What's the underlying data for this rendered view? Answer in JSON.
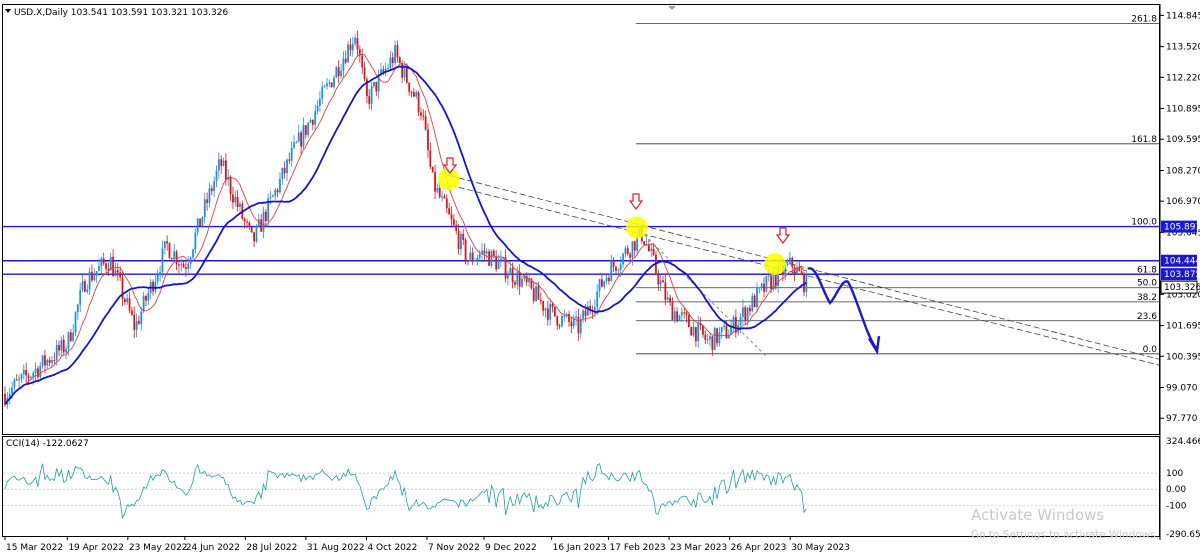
{
  "symbol_line": "USD.X,Daily  103.541 103.591 103.321 103.326",
  "cci_label": "CCI(14) -122.0627",
  "watermark": {
    "title": "Activate Windows",
    "subtitle": "Go to Settings to activate Windows."
  },
  "chart_data": [
    {
      "type": "candlestick",
      "title": "USD.X,Daily",
      "ohlc_last": {
        "open": 103.541,
        "high": 103.591,
        "low": 103.321,
        "close": 103.326
      },
      "ylim": [
        97.1,
        115.2
      ],
      "price_ticks": [
        "114.845",
        "113.520",
        "112.220",
        "110.895",
        "109.595",
        "108.270",
        "106.970",
        "105.645",
        "103.020",
        "101.695",
        "100.395",
        "99.070",
        "97.770"
      ],
      "highlighted_prices": [
        "105.891",
        "104.444",
        "103.875",
        "103.326"
      ],
      "x_ticks": [
        "15 Mar 2022",
        "19 Apr 2022",
        "23 May 2022",
        "24 Jun 2022",
        "28 Jul 2022",
        "31 Aug 2022",
        "4 Oct 2022",
        "7 Nov 2022",
        "9 Dec 2022",
        "16 Jan 2023",
        "17 Feb 2023",
        "23 Mar 2023",
        "26 Apr 2023",
        "30 May 2023"
      ],
      "horizontal_levels": [
        105.891,
        104.444,
        103.875
      ],
      "fibonacci": [
        {
          "label": "261.8",
          "price": 114.5
        },
        {
          "label": "161.8",
          "price": 109.4
        },
        {
          "label": "100.0",
          "price": 105.9
        },
        {
          "label": "61.8",
          "price": 103.87
        },
        {
          "label": "50.0",
          "price": 103.3
        },
        {
          "label": "38.2",
          "price": 102.7
        },
        {
          "label": "23.6",
          "price": 101.9
        },
        {
          "label": "0.0",
          "price": 100.5
        }
      ],
      "approx_close_path": [
        {
          "x": "15 Mar 2022",
          "y": 98.8
        },
        {
          "x": "19 Apr 2022",
          "y": 100.9
        },
        {
          "x": "29 Apr 2022",
          "y": 103.6
        },
        {
          "x": "13 May 2022",
          "y": 104.5
        },
        {
          "x": "27 May 2022",
          "y": 101.6
        },
        {
          "x": "14 Jun 2022",
          "y": 105.1
        },
        {
          "x": "24 Jun 2022",
          "y": 104.2
        },
        {
          "x": "14 Jul 2022",
          "y": 108.6
        },
        {
          "x": "1 Aug 2022",
          "y": 105.2
        },
        {
          "x": "23 Aug 2022",
          "y": 108.9
        },
        {
          "x": "28 Sep 2022",
          "y": 114.1
        },
        {
          "x": "4 Oct 2022",
          "y": 111.2
        },
        {
          "x": "20 Oct 2022",
          "y": 113.2
        },
        {
          "x": "4 Nov 2022",
          "y": 110.8
        },
        {
          "x": "10 Nov 2022",
          "y": 107.8
        },
        {
          "x": "30 Nov 2022",
          "y": 104.5
        },
        {
          "x": "9 Dec 2022",
          "y": 104.8
        },
        {
          "x": "30 Dec 2022",
          "y": 103.6
        },
        {
          "x": "16 Jan 2023",
          "y": 102.2
        },
        {
          "x": "31 Jan 2023",
          "y": 101.6
        },
        {
          "x": "17 Feb 2023",
          "y": 104.0
        },
        {
          "x": "8 Mar 2023",
          "y": 105.6
        },
        {
          "x": "23 Mar 2023",
          "y": 102.5
        },
        {
          "x": "14 Apr 2023",
          "y": 101.0
        },
        {
          "x": "26 Apr 2023",
          "y": 101.5
        },
        {
          "x": "18 May 2023",
          "y": 103.5
        },
        {
          "x": "31 May 2023",
          "y": 104.3
        },
        {
          "x": "9 Jun 2023",
          "y": 103.3
        }
      ]
    },
    {
      "type": "line",
      "title": "CCI(14)",
      "ylim": [
        -290.6597,
        324.4662
      ],
      "y_ticks": [
        "324.4662",
        "100",
        "0.00",
        "-100",
        "-290.6597"
      ],
      "levels": [
        100,
        0,
        -100
      ],
      "last_value": -122.0627
    }
  ]
}
